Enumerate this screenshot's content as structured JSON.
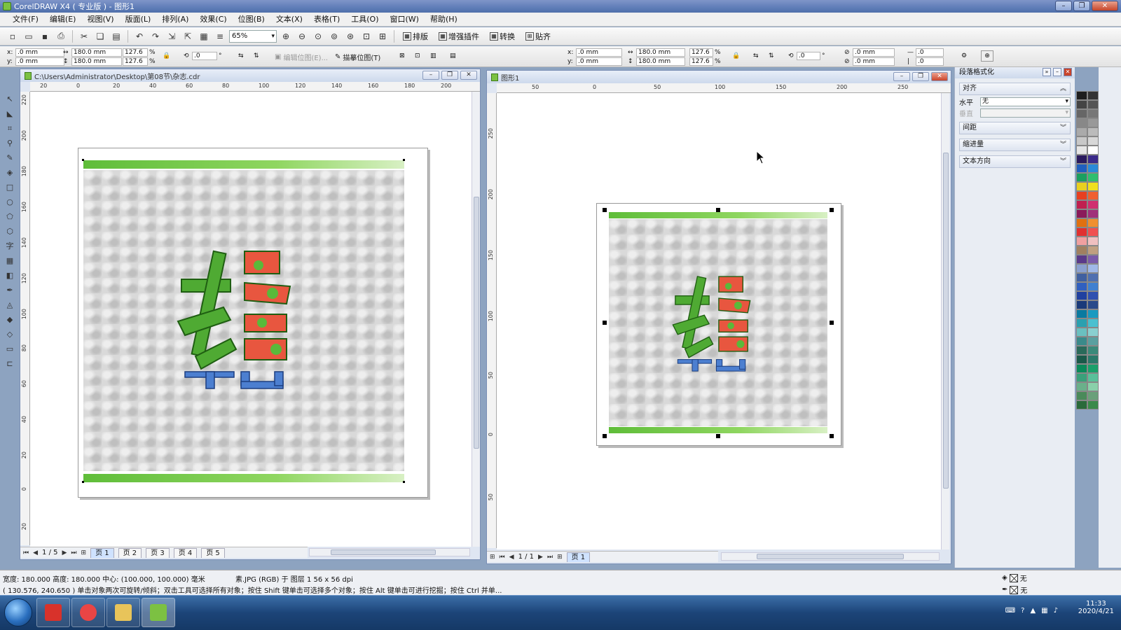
{
  "app": {
    "title": "CorelDRAW X4 ( 专业版 ) - 图形1"
  },
  "menu": [
    "文件(F)",
    "编辑(E)",
    "视图(V)",
    "版面(L)",
    "排列(A)",
    "效果(C)",
    "位图(B)",
    "文本(X)",
    "表格(T)",
    "工具(O)",
    "窗口(W)",
    "帮助(H)"
  ],
  "toolbar": {
    "zoom": "65%",
    "layout_label": "排版",
    "plugin_label": "增强插件",
    "convert_label": "转换",
    "snap_label": "贴齐"
  },
  "propbar_left": {
    "x": ".0 mm",
    "y": ".0 mm",
    "w": "180.0 mm",
    "h": "180.0 mm",
    "sx": "127.6",
    "sy": "127.6",
    "pct": "%",
    "rot": ".0",
    "deg": "°",
    "edit_bitmap": "编辑位图(E)...",
    "trace_bitmap": "描摹位图(T)"
  },
  "propbar_right": {
    "x": ".0 mm",
    "y": ".0 mm",
    "w": "180.0 mm",
    "h": "180.0 mm",
    "sx": "127.6",
    "sy": "127.6",
    "pct": "%",
    "rot": ".0",
    "deg": "°",
    "k1": ".0 mm",
    "k2": ".0 mm",
    "o1": ".0",
    "o2": ".0"
  },
  "doc_left": {
    "title": "C:\\Users\\Administrator\\Desktop\\第08节\\杂志.cdr",
    "hruler": [
      "20",
      "0",
      "20",
      "40",
      "60",
      "80",
      "100",
      "120",
      "140",
      "160",
      "180",
      "200"
    ],
    "hruler_unit": "毫米",
    "vruler": [
      "220",
      "200",
      "180",
      "160",
      "140",
      "120",
      "100",
      "80",
      "60",
      "40",
      "20",
      "0",
      "20"
    ],
    "page_count": "1 / 5",
    "pages": [
      "页 1",
      "页 2",
      "页 3",
      "页 4",
      "页 5"
    ]
  },
  "doc_right": {
    "title": "图形1",
    "hruler": [
      "50",
      "0",
      "50",
      "100",
      "150",
      "200",
      "250"
    ],
    "hruler_unit": "毫米",
    "vruler": [
      "250",
      "200",
      "150",
      "100",
      "50",
      "0",
      "50"
    ],
    "page_count": "1 / 1",
    "pages": [
      "页 1"
    ]
  },
  "docker": {
    "title": "段落格式化",
    "sections": [
      "对齐",
      "间距",
      "缩进量",
      "文本方向"
    ],
    "h_align_label": "水平",
    "h_align_value": "无",
    "v_align_label": "垂直"
  },
  "palette": [
    "#1e1e1e",
    "#333333",
    "#444444",
    "#555555",
    "#666666",
    "#777777",
    "#888888",
    "#999999",
    "#aaaaaa",
    "#bbbbbb",
    "#c8c8c8",
    "#d8d8d8",
    "#e6e6e6",
    "#ffffff",
    "#2a1a5e",
    "#3b2a8a",
    "#1f5fbf",
    "#2a8ad8",
    "#1a9f5f",
    "#2fbf6f",
    "#e8d020",
    "#f0e020",
    "#e84020",
    "#f06030",
    "#c02050",
    "#d03070",
    "#8a1a5a",
    "#a0307a",
    "#e07010",
    "#f09030",
    "#e03030",
    "#f05050",
    "#f0a0a0",
    "#f0c0c0",
    "#a08060",
    "#c0a080",
    "#5a3a8a",
    "#7a5aaa",
    "#8aa0d0",
    "#a0b8e8",
    "#4060a0",
    "#5070b0",
    "#3060c0",
    "#4080d0",
    "#2040a0",
    "#3050b0",
    "#1a3a7a",
    "#2a4a8a",
    "#0a7aa0",
    "#1a9ac0",
    "#2aa0b0",
    "#4ac0d0",
    "#6ac0c0",
    "#8ad0d0",
    "#3a8a8a",
    "#5aa0a0",
    "#2a6a5a",
    "#3a8a7a",
    "#1a5a4a",
    "#2a7a6a",
    "#0a8a5a",
    "#1aa06a",
    "#3aa07a",
    "#5ac09a",
    "#6ab08a",
    "#8ad0aa",
    "#4a8a5a",
    "#6aa07a",
    "#2a6a3a",
    "#3a8a4a"
  ],
  "status": {
    "line1": "宽度: 180.000  高度: 180.000  中心: (100.000, 100.000)  毫米",
    "line1b": "素.JPG (RGB) 于 图层 1  56 x 56 dpi",
    "line2": "( 130.576, 240.650 )    单击对象两次可旋转/倾斜；双击工具可选择所有对象；按住 Shift 键单击可选择多个对象；按住 Alt 键单击可进行挖掘；按住 Ctrl 并单...",
    "fill_label": "无",
    "outline_label": "无"
  },
  "taskbar": {
    "time": "11:33",
    "date": "2020/4/21"
  }
}
